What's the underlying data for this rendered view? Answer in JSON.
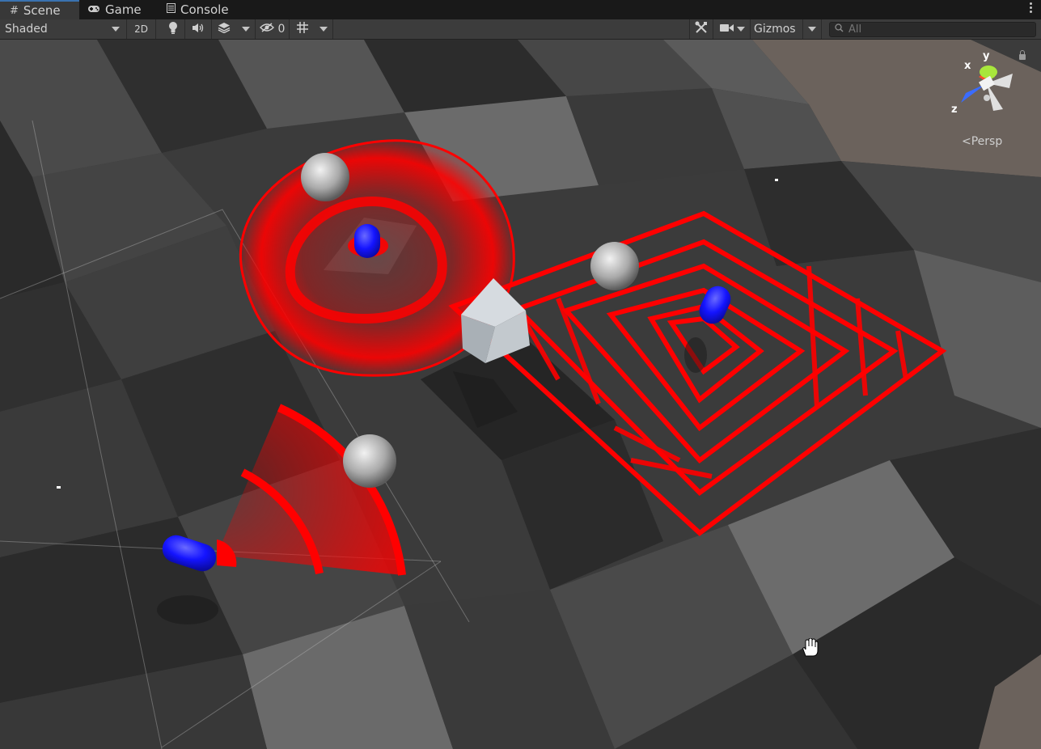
{
  "tabs": [
    {
      "label": "Scene",
      "icon": "hash-icon",
      "active": true
    },
    {
      "label": "Game",
      "icon": "gamepad-icon",
      "active": false
    },
    {
      "label": "Console",
      "icon": "console-icon",
      "active": false
    }
  ],
  "toolbar": {
    "shading_mode": "Shaded",
    "mode_2d": "2D",
    "hidden_count": "0",
    "gizmos_label": "Gizmos",
    "search_placeholder": "All"
  },
  "gizmo": {
    "x_label": "x",
    "y_label": "y",
    "z_label": "z",
    "projection_label": "Persp"
  },
  "colors": {
    "accent": "#3a72b0",
    "highlight_red": "#ff0000",
    "capsule_blue": "#1515ff"
  }
}
